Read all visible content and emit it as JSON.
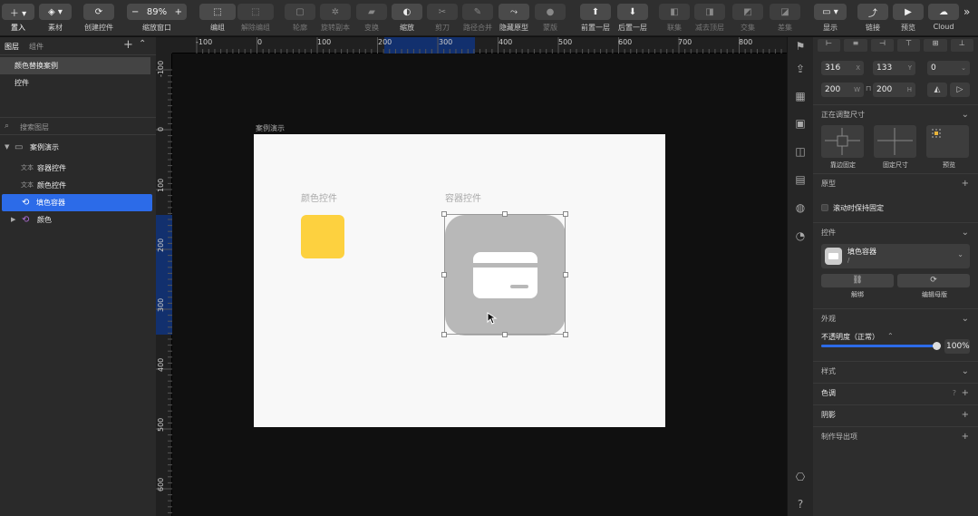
{
  "toolbar": {
    "insert": "置入",
    "assets": "素材",
    "create_control": "创建控件",
    "zoom_value": "89%",
    "zoom_label": "缩放窗口",
    "group": "编组",
    "ungroup": "解除编组",
    "outline": "轮廓",
    "rotate_copy": "旋转副本",
    "transform": "变换",
    "scale": "缩放",
    "cut": "剪刀",
    "path_merge": "路径合并",
    "hide_prototype": "隐藏原型",
    "mask": "蒙版",
    "bring_forward": "前置一层",
    "send_backward": "后置一层",
    "union": "联集",
    "subtract": "减去顶层",
    "intersect": "交集",
    "difference": "差集",
    "display": "显示",
    "link": "链接",
    "preview": "预览",
    "cloud": "Cloud"
  },
  "layers_panel": {
    "tab_layers": "图层",
    "tab_components": "组件",
    "pages": [
      "颜色替换案例",
      "控件"
    ],
    "search_placeholder": "搜索图层",
    "artboard": "案例演示",
    "rows": [
      {
        "tag": "文本",
        "name": "容器控件"
      },
      {
        "tag": "文本",
        "name": "颜色控件"
      },
      {
        "tag": "",
        "name": "填色容器"
      },
      {
        "tag": "",
        "name": "颜色"
      }
    ]
  },
  "rulers": {
    "top_labels": [
      "-100",
      "0",
      "100",
      "200",
      "300",
      "400",
      "500",
      "600",
      "700",
      "800"
    ],
    "left_labels": [
      "-100",
      "0",
      "100",
      "200",
      "300",
      "400",
      "500",
      "600"
    ]
  },
  "canvas": {
    "artboard_title": "案例演示",
    "color_label": "颜色控件",
    "container_label": "容器控件",
    "color_swatch": "#FDD13F",
    "container_fill": "#B8B8B8"
  },
  "inspector": {
    "x": "316",
    "x_unit": "X",
    "y": "133",
    "y_unit": "Y",
    "rot": "0",
    "w": "200",
    "w_unit": "W",
    "h": "200",
    "h_unit": "H",
    "resizing_title": "正在调整尺寸",
    "resize_options": [
      "靠边固定",
      "固定尺寸",
      "预览"
    ],
    "prototype": "原型",
    "fixed_on_scroll": "滚动时保持固定",
    "controls": "控件",
    "control_name": "填色容器",
    "control_sub": "/",
    "detach": "解绑",
    "edit_master": "编辑母版",
    "appearance": "外观",
    "opacity_label": "不透明度（正常）",
    "opacity_value": "100%",
    "style": "样式",
    "tint": "色调",
    "shadow": "阴影",
    "export": "制作导出项",
    "accent": "#2C6BE8"
  }
}
